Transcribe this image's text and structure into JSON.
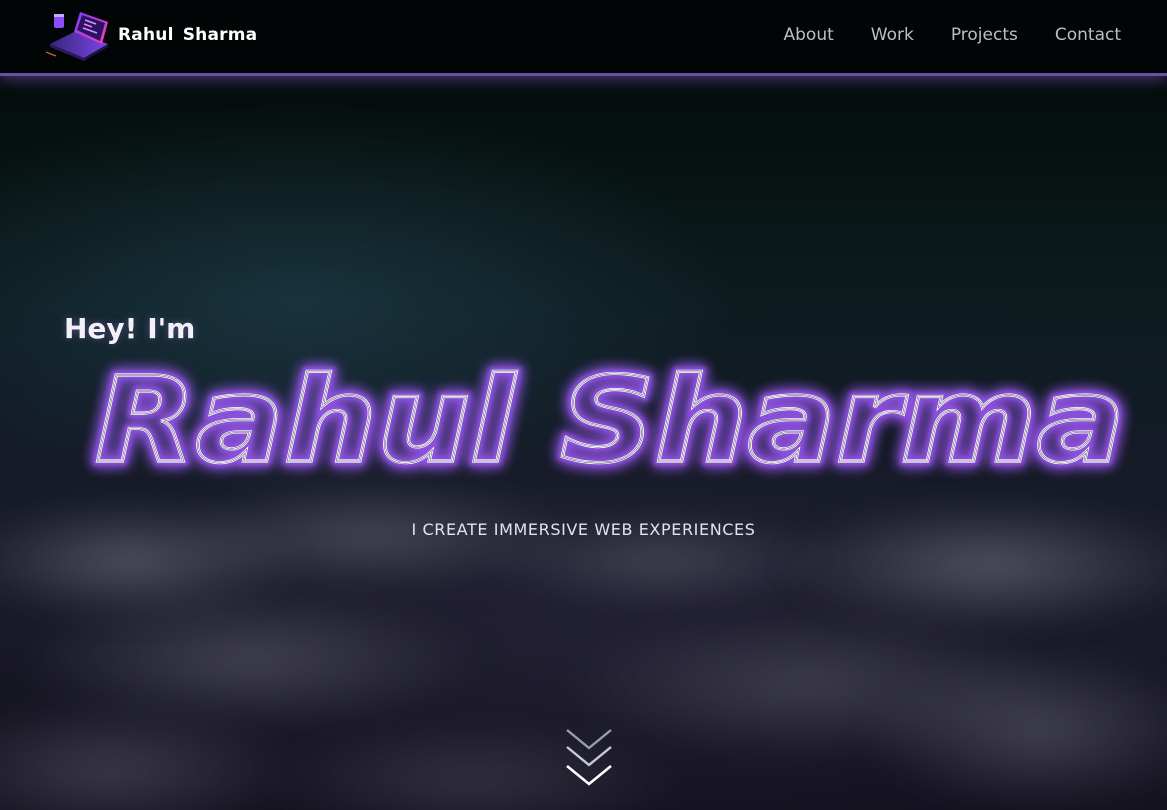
{
  "header": {
    "brand_name": "Rahul  Sharma",
    "logo_icon": "laptop-code-icon",
    "nav": [
      {
        "label": "About"
      },
      {
        "label": "Work"
      },
      {
        "label": "Projects"
      },
      {
        "label": "Contact"
      }
    ]
  },
  "hero": {
    "greeting": "Hey! I'm",
    "name": "Rahul Sharma",
    "tagline": "I CREATE IMMERSIVE WEB EXPERIENCES",
    "scroll_icon": "double-chevron-down-icon"
  },
  "colors": {
    "navbar_bg": "#020506",
    "navbar_border": "#6b4fa0",
    "neon_glow": "#a35cff",
    "neon_text": "#ffffff",
    "nav_link": "#b9bfc6"
  }
}
